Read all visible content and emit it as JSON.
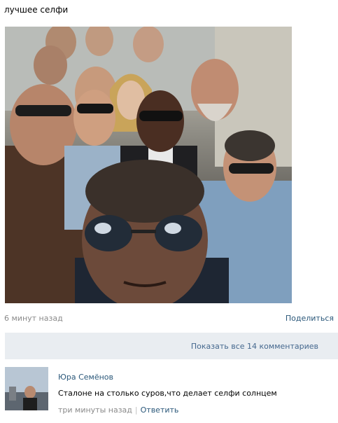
{
  "post": {
    "title": "лучшее селфи",
    "time": "6 минут назад",
    "share_label": "Поделиться"
  },
  "comments_bar": {
    "label": "Показать все 14 комментариев"
  },
  "comment": {
    "author": "Юра Семёнов",
    "text": "Сталоне на столько суров,что делает селфи солнцем",
    "time": "три минуты назад",
    "separator": "|",
    "reply_label": "Ответить"
  },
  "colors": {
    "link": "#2b587a",
    "muted": "#8a8a8a",
    "bar_background": "#e9edf1",
    "bar_text": "#45688e"
  }
}
